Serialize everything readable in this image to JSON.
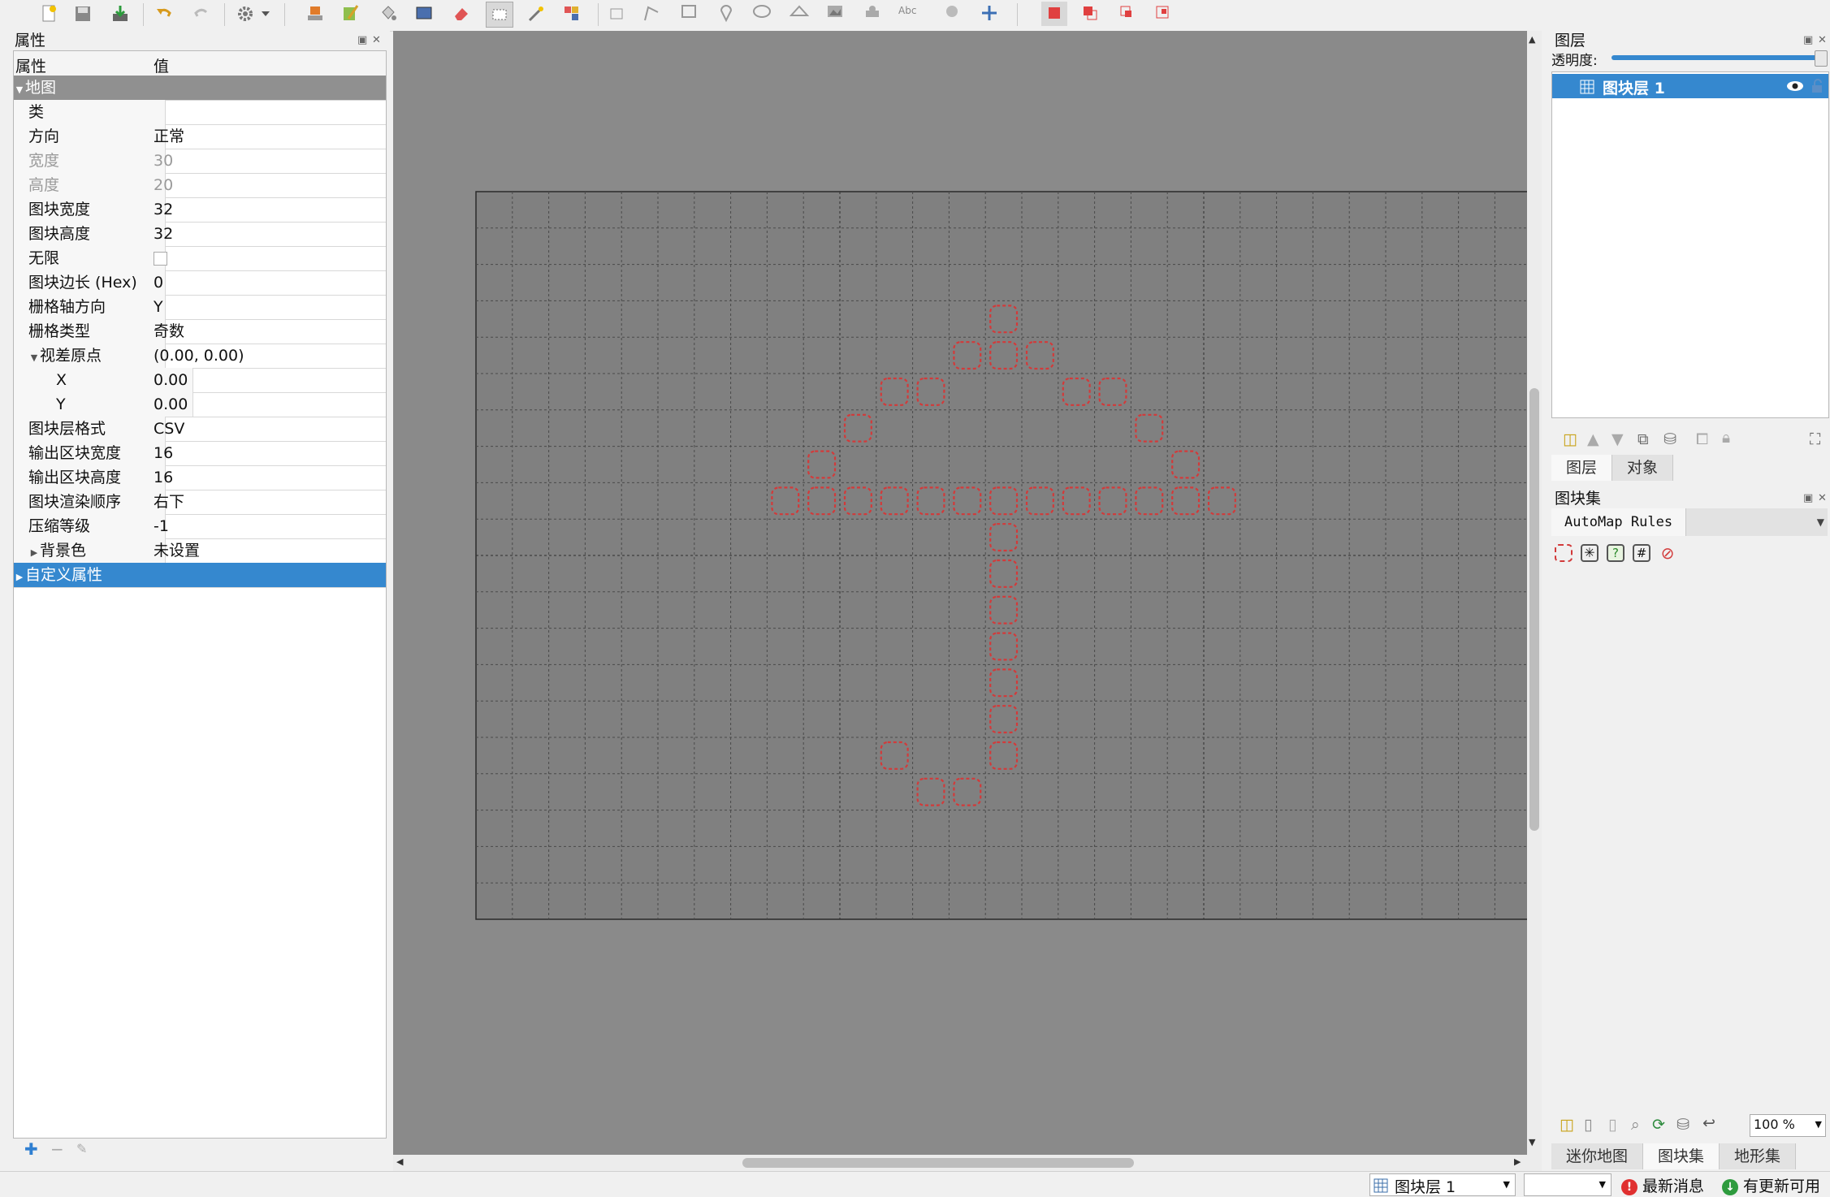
{
  "properties_panel": {
    "title": "属性",
    "header": {
      "name_col": "属性",
      "value_col": "值"
    },
    "rows": [
      {
        "name": "地图",
        "value": "",
        "kind": "group"
      },
      {
        "name": "类",
        "value": ""
      },
      {
        "name": "方向",
        "value": "正常"
      },
      {
        "name": "宽度",
        "value": "30",
        "kind": "dim"
      },
      {
        "name": "高度",
        "value": "20",
        "kind": "dim"
      },
      {
        "name": "图块宽度",
        "value": "32"
      },
      {
        "name": "图块高度",
        "value": "32"
      },
      {
        "name": "无限",
        "value": "",
        "kind": "checkbox"
      },
      {
        "name": "图块边长 (Hex)",
        "value": "0"
      },
      {
        "name": "栅格轴方向",
        "value": "Y"
      },
      {
        "name": "栅格类型",
        "value": "奇数"
      },
      {
        "name": "视差原点",
        "value": "(0.00, 0.00)",
        "kind": "expanded"
      },
      {
        "name": "X",
        "value": "0.00",
        "kind": "sub"
      },
      {
        "name": "Y",
        "value": "0.00",
        "kind": "sub"
      },
      {
        "name": "图块层格式",
        "value": "CSV"
      },
      {
        "name": "输出区块宽度",
        "value": "16"
      },
      {
        "name": "输出区块高度",
        "value": "16"
      },
      {
        "name": "图块渲染顺序",
        "value": "右下"
      },
      {
        "name": "压缩等级",
        "value": "-1"
      },
      {
        "name": "背景色",
        "value": "未设置",
        "kind": "collapsed"
      },
      {
        "name": "自定义属性",
        "value": "",
        "kind": "selected"
      }
    ]
  },
  "layers_panel": {
    "title": "图层",
    "opacity_label": "透明度:",
    "opacity": 1.0,
    "layers": [
      {
        "name": "图块层 1",
        "visible": true,
        "locked": false,
        "selected": true
      }
    ],
    "tabs": [
      "图层",
      "对象"
    ]
  },
  "tilesets_panel": {
    "title": "图块集",
    "tabs": [
      "AutoMap Rules"
    ],
    "bottom_tabs": [
      "迷你地图",
      "图块集",
      "地形集"
    ],
    "zoom": "100 %"
  },
  "map": {
    "cols": 30,
    "rows": 20,
    "marked_tiles": [
      [
        14,
        3
      ],
      [
        13,
        4
      ],
      [
        14,
        4
      ],
      [
        15,
        4
      ],
      [
        11,
        5
      ],
      [
        12,
        5
      ],
      [
        16,
        5
      ],
      [
        17,
        5
      ],
      [
        10,
        6
      ],
      [
        18,
        6
      ],
      [
        9,
        7
      ],
      [
        19,
        7
      ],
      [
        8,
        8
      ],
      [
        9,
        8
      ],
      [
        10,
        8
      ],
      [
        11,
        8
      ],
      [
        12,
        8
      ],
      [
        13,
        8
      ],
      [
        14,
        8
      ],
      [
        15,
        8
      ],
      [
        16,
        8
      ],
      [
        17,
        8
      ],
      [
        18,
        8
      ],
      [
        19,
        8
      ],
      [
        20,
        8
      ],
      [
        14,
        9
      ],
      [
        14,
        10
      ],
      [
        14,
        11
      ],
      [
        14,
        12
      ],
      [
        14,
        13
      ],
      [
        14,
        14
      ],
      [
        11,
        15
      ],
      [
        14,
        15
      ],
      [
        12,
        16
      ],
      [
        13,
        16
      ]
    ]
  },
  "status_bar": {
    "current_layer": "图块层 1",
    "news": "最新消息",
    "update": "有更新可用"
  },
  "colors": {
    "selection": "#3588cf",
    "canvas_bg": "#8a8a8a",
    "map_bg": "#808080",
    "tile_marker": "#d23a3a"
  }
}
